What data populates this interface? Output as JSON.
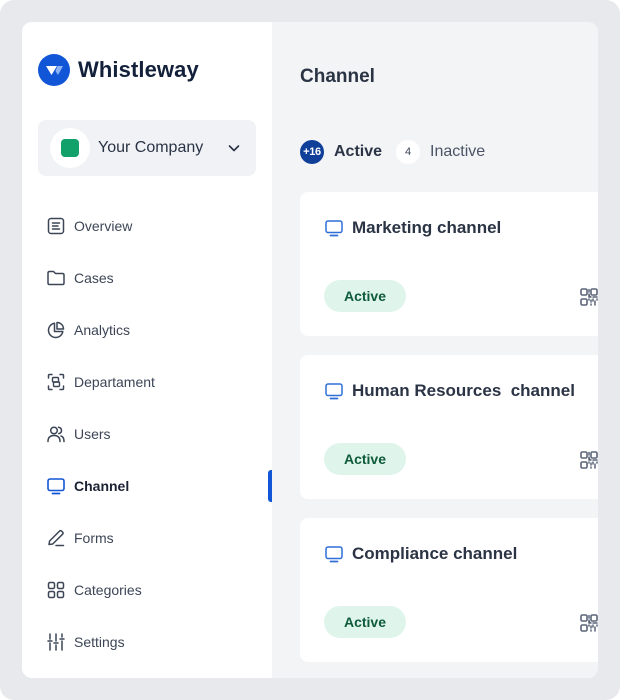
{
  "brand": {
    "name": "Whistleway",
    "logo_icon": "whistleway-logo-icon",
    "logo_color": "#1156d6"
  },
  "company_selector": {
    "name": "Your Company",
    "swatch_color": "#12a06b",
    "chevron_icon": "chevron-down-icon"
  },
  "sidebar": {
    "items": [
      {
        "label": "Overview",
        "icon": "document-list-icon",
        "active": false
      },
      {
        "label": "Cases",
        "icon": "folder-icon",
        "active": false
      },
      {
        "label": "Analytics",
        "icon": "pie-chart-icon",
        "active": false
      },
      {
        "label": "Departament",
        "icon": "scan-group-icon",
        "active": false
      },
      {
        "label": "Users",
        "icon": "users-icon",
        "active": false
      },
      {
        "label": "Channel",
        "icon": "monitor-icon",
        "active": true
      },
      {
        "label": "Forms",
        "icon": "pencil-icon",
        "active": false
      },
      {
        "label": "Categories",
        "icon": "grid-icon",
        "active": false
      },
      {
        "label": "Settings",
        "icon": "sliders-icon",
        "active": false
      }
    ],
    "accent_color": "#1156d6"
  },
  "main": {
    "title": "Channel",
    "filters": {
      "active": {
        "count": "+16",
        "label": "Active"
      },
      "inactive": {
        "count": "4",
        "label": "Inactive"
      }
    },
    "channels": [
      {
        "title": "Marketing channel",
        "status": "Active",
        "action_icon": "qr-code-icon"
      },
      {
        "title": "Human Resources  channel",
        "status": "Active",
        "action_icon": "qr-code-icon"
      },
      {
        "title": "Compliance channel",
        "status": "Active",
        "action_icon": "qr-code-icon"
      }
    ]
  }
}
